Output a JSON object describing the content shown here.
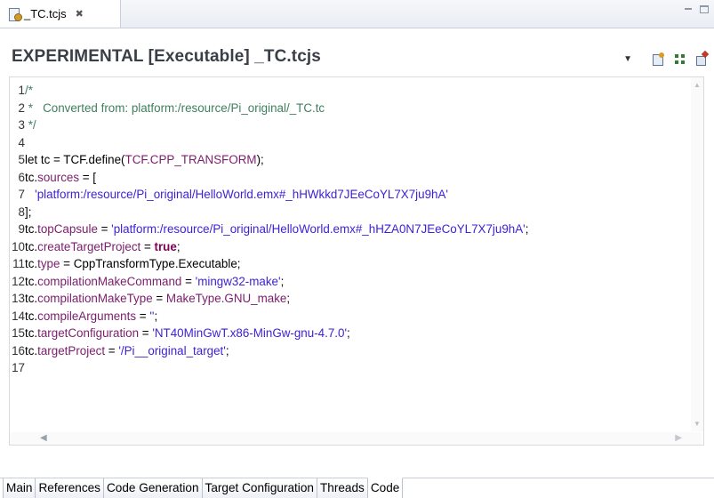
{
  "editor_tab": {
    "label": "_TC.tcjs",
    "close_glyph": "⌦"
  },
  "header": {
    "title": "EXPERIMENTAL [Executable] _TC.tcjs",
    "dropdown_glyph": "▼"
  },
  "code": {
    "lines": [
      {
        "n": "1",
        "tokens": [
          {
            "t": "/*",
            "k": "comment"
          }
        ]
      },
      {
        "n": "2",
        "tokens": [
          {
            "t": " *   Converted from: platform:/resource/Pi_original/_TC.tc",
            "k": "comment"
          }
        ]
      },
      {
        "n": "3",
        "tokens": [
          {
            "t": " */",
            "k": "comment"
          }
        ]
      },
      {
        "n": "4",
        "tokens": []
      },
      {
        "n": "5",
        "tokens": [
          {
            "t": "let tc = TCF.define(",
            "k": "plain"
          },
          {
            "t": "TCF.CPP_TRANSFORM",
            "k": "purple"
          },
          {
            "t": ");",
            "k": "plain"
          }
        ]
      },
      {
        "n": "6",
        "tokens": [
          {
            "t": "tc.",
            "k": "plain"
          },
          {
            "t": "sources",
            "k": "purple"
          },
          {
            "t": " = [",
            "k": "plain"
          }
        ]
      },
      {
        "n": "7",
        "tokens": [
          {
            "t": "   'platform:/resource/Pi_original/HelloWorld.emx#_hHWkkd7JEeCoYL7X7ju9hA'",
            "k": "str"
          }
        ]
      },
      {
        "n": "8",
        "tokens": [
          {
            "t": "];",
            "k": "plain"
          }
        ]
      },
      {
        "n": "9",
        "tokens": [
          {
            "t": "tc.",
            "k": "plain"
          },
          {
            "t": "topCapsule",
            "k": "purple"
          },
          {
            "t": " = ",
            "k": "plain"
          },
          {
            "t": "'platform:/resource/Pi_original/HelloWorld.emx#_hHZA0N7JEeCoYL7X7ju9hA'",
            "k": "str"
          },
          {
            "t": ";",
            "k": "plain"
          }
        ]
      },
      {
        "n": "10",
        "tokens": [
          {
            "t": "tc.",
            "k": "plain"
          },
          {
            "t": "createTargetProject",
            "k": "purple"
          },
          {
            "t": " = ",
            "k": "plain"
          },
          {
            "t": "true",
            "k": "kw"
          },
          {
            "t": ";",
            "k": "plain"
          }
        ]
      },
      {
        "n": "11",
        "tokens": [
          {
            "t": "tc.",
            "k": "plain"
          },
          {
            "t": "type",
            "k": "purple"
          },
          {
            "t": " = CppTransformType.Executable;",
            "k": "plain"
          }
        ]
      },
      {
        "n": "12",
        "tokens": [
          {
            "t": "tc.",
            "k": "plain"
          },
          {
            "t": "compilationMakeCommand",
            "k": "purple"
          },
          {
            "t": " = ",
            "k": "plain"
          },
          {
            "t": "'mingw32-make'",
            "k": "str"
          },
          {
            "t": ";",
            "k": "plain"
          }
        ]
      },
      {
        "n": "13",
        "tokens": [
          {
            "t": "tc.",
            "k": "plain"
          },
          {
            "t": "compilationMakeType",
            "k": "purple"
          },
          {
            "t": " = ",
            "k": "plain"
          },
          {
            "t": "MakeType.GNU_make",
            "k": "purple"
          },
          {
            "t": ";",
            "k": "plain"
          }
        ]
      },
      {
        "n": "14",
        "tokens": [
          {
            "t": "tc.",
            "k": "plain"
          },
          {
            "t": "compileArguments",
            "k": "purple"
          },
          {
            "t": " = ",
            "k": "plain"
          },
          {
            "t": "''",
            "k": "str"
          },
          {
            "t": ";",
            "k": "plain"
          }
        ]
      },
      {
        "n": "15",
        "tokens": [
          {
            "t": "tc.",
            "k": "plain"
          },
          {
            "t": "targetConfiguration",
            "k": "purple"
          },
          {
            "t": " = ",
            "k": "plain"
          },
          {
            "t": "'NT40MinGwT.x86-MinGw-gnu-4.7.0'",
            "k": "str"
          },
          {
            "t": ";",
            "k": "plain"
          }
        ]
      },
      {
        "n": "16",
        "tokens": [
          {
            "t": "tc.",
            "k": "plain"
          },
          {
            "t": "targetProject",
            "k": "purple"
          },
          {
            "t": " = ",
            "k": "plain"
          },
          {
            "t": "'/Pi__original_target'",
            "k": "str"
          },
          {
            "t": ";",
            "k": "plain"
          }
        ]
      },
      {
        "n": "17",
        "tokens": []
      }
    ]
  },
  "bottom_tabs": [
    {
      "label": "Main",
      "active": false
    },
    {
      "label": "References",
      "active": false
    },
    {
      "label": "Code Generation",
      "active": false
    },
    {
      "label": "Target Configuration",
      "active": false
    },
    {
      "label": "Threads",
      "active": false
    },
    {
      "label": "Code",
      "active": true
    }
  ],
  "colors": {
    "comment": "#3f7f5f",
    "purple": "#7a1e6b",
    "string": "#3d1fd6",
    "keyword": "#7f0055"
  },
  "icons": [
    "tcjs-file-icon",
    "close-icon",
    "minimize-icon",
    "maximize-icon",
    "dropdown-icon",
    "build-icon",
    "grid-icon",
    "wand-icon"
  ]
}
